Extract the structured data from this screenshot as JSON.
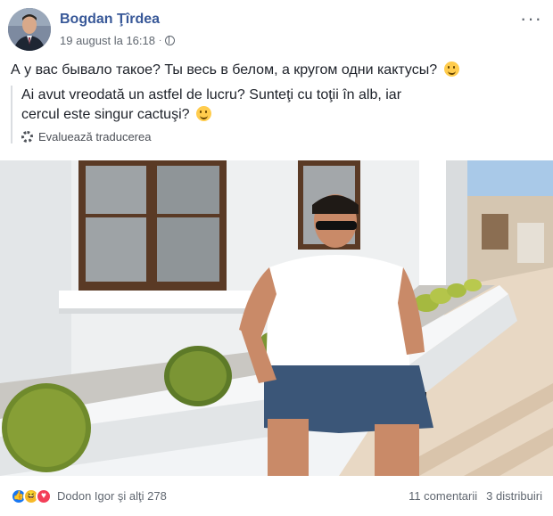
{
  "post": {
    "author": "Bogdan Ţîrdea",
    "timestamp": "19 august la 16:18",
    "separator": "·",
    "more_label": "···",
    "text_original": "А у вас бывало такое? Ты весь в белом, а кругом одни кактусы?",
    "text_translated": "Ai avut vreodată un astfel de lucru? Sunteţi cu toţii în alb, iar cercul este singur cactuşi?",
    "translate_label": "Evaluează traducerea",
    "privacy_icon": "globe-icon",
    "emoji_icon": "smile-emoji"
  },
  "footer": {
    "reactions": [
      "like",
      "haha",
      "love"
    ],
    "reactors": "Dodon Igor şi alţi 278",
    "comments": "11 comentarii",
    "shares": "3 distribuiri"
  },
  "colors": {
    "author_link": "#385898",
    "text": "#1d2129",
    "secondary": "#606770",
    "like": "#1877f2",
    "love": "#f33e58",
    "haha": "#f7b928"
  }
}
